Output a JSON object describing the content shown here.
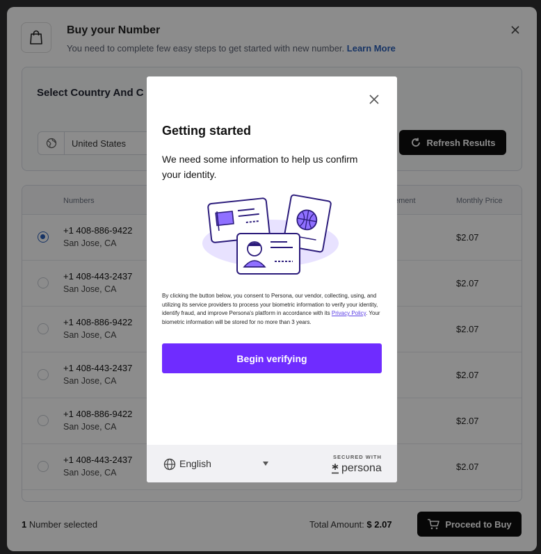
{
  "header": {
    "title": "Buy your Number",
    "subtitle": "You need to complete few easy steps to get started with new number.",
    "learn_more": "Learn More"
  },
  "country": {
    "title": "Select Country And C",
    "selected": "United States",
    "refresh_label": "Refresh Results"
  },
  "table": {
    "col_numbers": "Numbers",
    "col_partial": "ement",
    "col_monthly": "Monthly Price",
    "rows": [
      {
        "number": "+1 408-886-9422",
        "city": "San Jose, CA",
        "price": "$2.07",
        "selected": true
      },
      {
        "number": "+1 408-443-2437",
        "city": "San Jose, CA",
        "price": "$2.07",
        "selected": false
      },
      {
        "number": "+1 408-886-9422",
        "city": "San Jose, CA",
        "price": "$2.07",
        "selected": false
      },
      {
        "number": "+1 408-443-2437",
        "city": "San Jose, CA",
        "price": "$2.07",
        "selected": false
      },
      {
        "number": "+1 408-886-9422",
        "city": "San Jose, CA",
        "price": "$2.07",
        "selected": false
      },
      {
        "number": "+1 408-443-2437",
        "city": "San Jose, CA",
        "price": "$2.07",
        "selected": false
      }
    ]
  },
  "footer": {
    "selected_count": "1",
    "selected_text": "Number selected",
    "total_label": "Total Amount:",
    "total_value": "$ 2.07",
    "buy_label": "Proceed to Buy"
  },
  "modal": {
    "title": "Getting started",
    "description": "We need some information to help us confirm your identity.",
    "consent_pre": "By clicking the button below, you consent to Persona, our vendor, collecting, using, and utilizing its service providers to process your biometric information to verify your identity, identify fraud, and improve Persona's platform in accordance with its",
    "privacy_link": "Privacy Policy",
    "consent_post": ". Your biometric information will be stored for no more than 3 years.",
    "begin_label": "Begin verifying",
    "language": "English",
    "secured_with": "SECURED WITH",
    "brand": "persona"
  },
  "colors": {
    "accent": "#6f2cff",
    "link": "#2b5fb8",
    "dark_button": "#0d0d0d"
  }
}
